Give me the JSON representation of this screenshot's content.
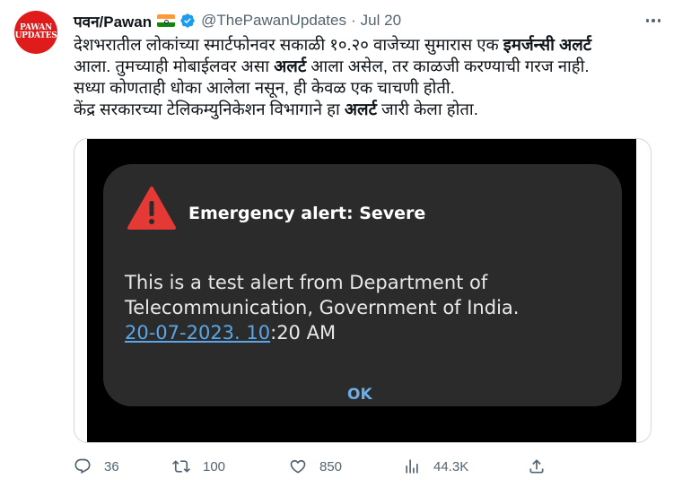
{
  "avatar": {
    "logo_text": "PAWAN UPDATES"
  },
  "header": {
    "name": "पवन/Pawan",
    "handle": "@ThePawanUpdates",
    "separator": "·",
    "date": "Jul 20",
    "flag_icon": "india-flag-icon",
    "verified_icon": "verified-badge-icon",
    "verified_color": "#1d9bf0"
  },
  "tweet": {
    "line1_a": "देशभरातील लोकांच्या स्मार्टफोनवर सकाळी १०.२० वाजेच्या सुमारास एक ",
    "line1_b": "इमर्जन्सी अलर्ट",
    "line2_a": "आला. तुमच्याही मोबाईलवर असा ",
    "line2_b": "अलर्ट",
    "line2_c": " आला असेल, तर काळजी करण्याची गरज नाही.",
    "line3": "सध्या कोणताही धोका आलेला नसून, ही केवळ एक चाचणी होती.",
    "line4_a": "केंद्र सरकारच्या टेलिकम्युनिकेशन विभागाने हा ",
    "line4_b": "अलर्ट",
    "line4_c": " जारी केला होता."
  },
  "media": {
    "alert_icon": "warning-triangle-icon",
    "alert_title": "Emergency alert: Severe",
    "body_line1": "This is a test alert from Department of",
    "body_line2": "Telecommunication, Government of India.",
    "body_link": "20-07-2023. 10",
    "body_time_rest": ":20 AM",
    "ok_label": "OK",
    "alert_color": "#e53935",
    "link_color": "#5aa6e6"
  },
  "actions": {
    "reply": {
      "icon": "reply-icon",
      "count": "36"
    },
    "retweet": {
      "icon": "retweet-icon",
      "count": "100"
    },
    "like": {
      "icon": "heart-icon",
      "count": "850"
    },
    "views": {
      "icon": "views-chart-icon",
      "count": "44.3K"
    },
    "share": {
      "icon": "share-icon"
    }
  }
}
